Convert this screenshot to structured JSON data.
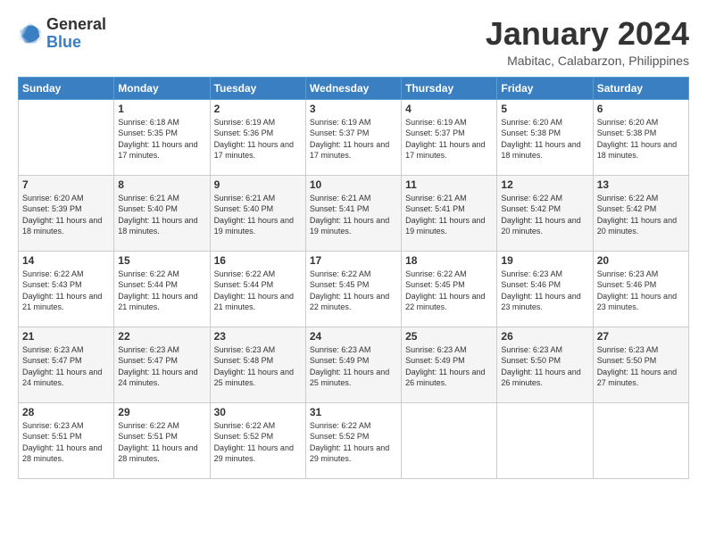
{
  "header": {
    "logo_general": "General",
    "logo_blue": "Blue",
    "month_title": "January 2024",
    "location": "Mabitac, Calabarzon, Philippines"
  },
  "weekdays": [
    "Sunday",
    "Monday",
    "Tuesday",
    "Wednesday",
    "Thursday",
    "Friday",
    "Saturday"
  ],
  "weeks": [
    [
      null,
      {
        "day": "1",
        "sunrise": "6:18 AM",
        "sunset": "5:35 PM",
        "daylight": "11 hours and 17 minutes."
      },
      {
        "day": "2",
        "sunrise": "6:19 AM",
        "sunset": "5:36 PM",
        "daylight": "11 hours and 17 minutes."
      },
      {
        "day": "3",
        "sunrise": "6:19 AM",
        "sunset": "5:37 PM",
        "daylight": "11 hours and 17 minutes."
      },
      {
        "day": "4",
        "sunrise": "6:19 AM",
        "sunset": "5:37 PM",
        "daylight": "11 hours and 17 minutes."
      },
      {
        "day": "5",
        "sunrise": "6:20 AM",
        "sunset": "5:38 PM",
        "daylight": "11 hours and 18 minutes."
      },
      {
        "day": "6",
        "sunrise": "6:20 AM",
        "sunset": "5:38 PM",
        "daylight": "11 hours and 18 minutes."
      }
    ],
    [
      {
        "day": "7",
        "sunrise": "6:20 AM",
        "sunset": "5:39 PM",
        "daylight": "11 hours and 18 minutes."
      },
      {
        "day": "8",
        "sunrise": "6:21 AM",
        "sunset": "5:40 PM",
        "daylight": "11 hours and 18 minutes."
      },
      {
        "day": "9",
        "sunrise": "6:21 AM",
        "sunset": "5:40 PM",
        "daylight": "11 hours and 19 minutes."
      },
      {
        "day": "10",
        "sunrise": "6:21 AM",
        "sunset": "5:41 PM",
        "daylight": "11 hours and 19 minutes."
      },
      {
        "day": "11",
        "sunrise": "6:21 AM",
        "sunset": "5:41 PM",
        "daylight": "11 hours and 19 minutes."
      },
      {
        "day": "12",
        "sunrise": "6:22 AM",
        "sunset": "5:42 PM",
        "daylight": "11 hours and 20 minutes."
      },
      {
        "day": "13",
        "sunrise": "6:22 AM",
        "sunset": "5:42 PM",
        "daylight": "11 hours and 20 minutes."
      }
    ],
    [
      {
        "day": "14",
        "sunrise": "6:22 AM",
        "sunset": "5:43 PM",
        "daylight": "11 hours and 21 minutes."
      },
      {
        "day": "15",
        "sunrise": "6:22 AM",
        "sunset": "5:44 PM",
        "daylight": "11 hours and 21 minutes."
      },
      {
        "day": "16",
        "sunrise": "6:22 AM",
        "sunset": "5:44 PM",
        "daylight": "11 hours and 21 minutes."
      },
      {
        "day": "17",
        "sunrise": "6:22 AM",
        "sunset": "5:45 PM",
        "daylight": "11 hours and 22 minutes."
      },
      {
        "day": "18",
        "sunrise": "6:22 AM",
        "sunset": "5:45 PM",
        "daylight": "11 hours and 22 minutes."
      },
      {
        "day": "19",
        "sunrise": "6:23 AM",
        "sunset": "5:46 PM",
        "daylight": "11 hours and 23 minutes."
      },
      {
        "day": "20",
        "sunrise": "6:23 AM",
        "sunset": "5:46 PM",
        "daylight": "11 hours and 23 minutes."
      }
    ],
    [
      {
        "day": "21",
        "sunrise": "6:23 AM",
        "sunset": "5:47 PM",
        "daylight": "11 hours and 24 minutes."
      },
      {
        "day": "22",
        "sunrise": "6:23 AM",
        "sunset": "5:47 PM",
        "daylight": "11 hours and 24 minutes."
      },
      {
        "day": "23",
        "sunrise": "6:23 AM",
        "sunset": "5:48 PM",
        "daylight": "11 hours and 25 minutes."
      },
      {
        "day": "24",
        "sunrise": "6:23 AM",
        "sunset": "5:49 PM",
        "daylight": "11 hours and 25 minutes."
      },
      {
        "day": "25",
        "sunrise": "6:23 AM",
        "sunset": "5:49 PM",
        "daylight": "11 hours and 26 minutes."
      },
      {
        "day": "26",
        "sunrise": "6:23 AM",
        "sunset": "5:50 PM",
        "daylight": "11 hours and 26 minutes."
      },
      {
        "day": "27",
        "sunrise": "6:23 AM",
        "sunset": "5:50 PM",
        "daylight": "11 hours and 27 minutes."
      }
    ],
    [
      {
        "day": "28",
        "sunrise": "6:23 AM",
        "sunset": "5:51 PM",
        "daylight": "11 hours and 28 minutes."
      },
      {
        "day": "29",
        "sunrise": "6:22 AM",
        "sunset": "5:51 PM",
        "daylight": "11 hours and 28 minutes."
      },
      {
        "day": "30",
        "sunrise": "6:22 AM",
        "sunset": "5:52 PM",
        "daylight": "11 hours and 29 minutes."
      },
      {
        "day": "31",
        "sunrise": "6:22 AM",
        "sunset": "5:52 PM",
        "daylight": "11 hours and 29 minutes."
      },
      null,
      null,
      null
    ]
  ]
}
